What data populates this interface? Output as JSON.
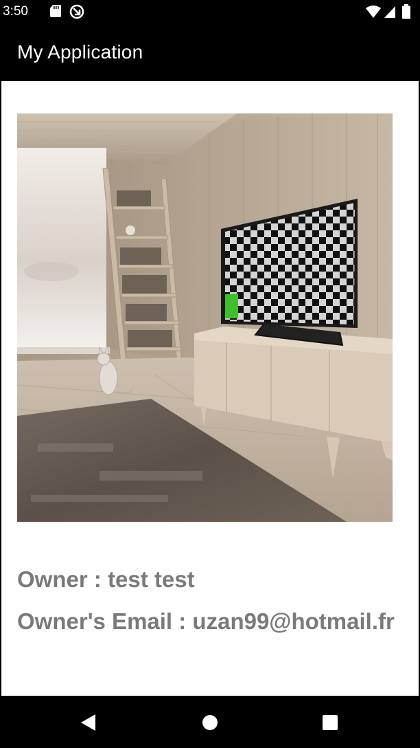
{
  "status_bar": {
    "time": "3:50",
    "left_icons": [
      "sd-card-icon",
      "sync-icon"
    ],
    "right_icons": [
      "wifi-icon",
      "cell-signal-icon",
      "battery-icon"
    ]
  },
  "app_bar": {
    "title": "My Application"
  },
  "main": {
    "image": {
      "icon": "living-room-photo"
    },
    "owner_text": "Owner : test test",
    "email_text": "Owner's Email : uzan99@hotmail.fr",
    "text_color": "#7a7a7a"
  },
  "nav_bar": {
    "buttons": [
      "back-icon",
      "home-icon",
      "recents-icon"
    ]
  }
}
